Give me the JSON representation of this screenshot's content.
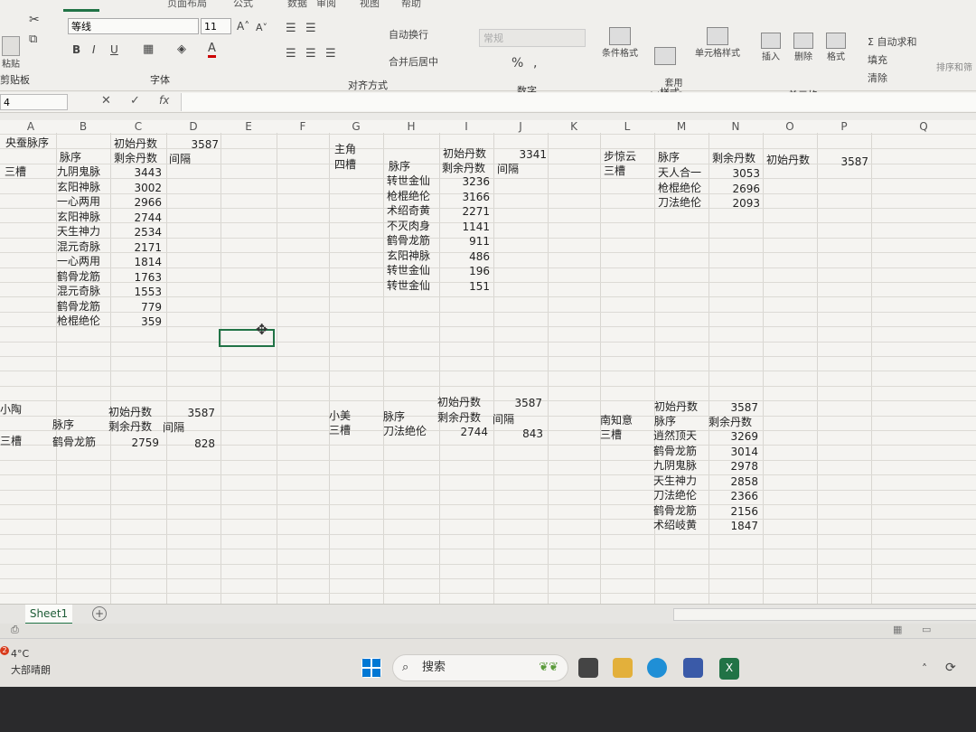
{
  "ribbon": {
    "tabs": [
      "页面布局",
      "公式",
      "数据",
      "审阅",
      "视图",
      "帮助"
    ],
    "font_name": "等线",
    "font_size": "11",
    "number_format": "常规",
    "wrap_text": "自动换行",
    "merge_center": "合并后居中",
    "cond_format": "条件格式",
    "table_format": "套用\n表格格式",
    "cell_style": "单元格样式",
    "insert": "插入",
    "delete": "删除",
    "format": "格式",
    "autosum": "自动求和",
    "fill": "填充",
    "clear": "清除",
    "sort": "排序和筛",
    "groups": {
      "clipboard": "剪贴板",
      "font": "字体",
      "align": "对齐方式",
      "number": "数字",
      "styles": "样式",
      "cells": "单元格",
      "edit": "编辑"
    },
    "paste": "粘贴",
    "bold": "B",
    "italic": "I",
    "underline": "U"
  },
  "formula_bar": {
    "name_box": "4",
    "fx": "fx"
  },
  "columns": [
    "A",
    "B",
    "C",
    "D",
    "E",
    "F",
    "G",
    "H",
    "I",
    "J",
    "K",
    "L",
    "M",
    "N",
    "O",
    "P",
    "Q",
    "R"
  ],
  "sheet_tab": "Sheet1",
  "taskbar": {
    "weather_temp": "4°C",
    "weather_desc": "大部晴朗",
    "search": "搜索",
    "badge": "2"
  },
  "accent": "#217346",
  "block1": {
    "title": "央蚕脉序",
    "h1": "初始丹数",
    "v1": "3587",
    "h_mai": "脉序",
    "h_rem": "剩余丹数",
    "h_gap": "间隔",
    "slot": "三槽",
    "rows": [
      [
        "九阴鬼脉",
        "3443"
      ],
      [
        "玄阳神脉",
        "3002"
      ],
      [
        "一心两用",
        "2966"
      ],
      [
        "玄阳神脉",
        "2744"
      ],
      [
        "天生神力",
        "2534"
      ],
      [
        "混元奇脉",
        "2171"
      ],
      [
        "一心两用",
        "1814"
      ],
      [
        "鹤骨龙筋",
        "1763"
      ],
      [
        "混元奇脉",
        "1553"
      ],
      [
        "鹤骨龙筋",
        "779"
      ],
      [
        "枪棍绝伦",
        "359"
      ]
    ]
  },
  "block2": {
    "title": "主角",
    "h1": "初始丹数",
    "v1": "3341",
    "slot": "四槽",
    "h_mai": "脉序",
    "h_rem": "剩余丹数",
    "h_gap": "间隔",
    "rows": [
      [
        "转世金仙",
        "3236"
      ],
      [
        "枪棍绝伦",
        "3166"
      ],
      [
        "术绍奇黄",
        "2271"
      ],
      [
        "不灭肉身",
        "1141"
      ],
      [
        "鹤骨龙筋",
        "911"
      ],
      [
        "玄阳神脉",
        "486"
      ],
      [
        "转世金仙",
        "196"
      ],
      [
        "转世金仙",
        "151"
      ]
    ]
  },
  "block3": {
    "title": "步惊云",
    "slot": "三槽",
    "h_mai": "脉序",
    "h_rem": "剩余丹数",
    "h_init": "初始丹数",
    "v1": "3587",
    "rows": [
      [
        "天人合一",
        "3053"
      ],
      [
        "枪棍绝伦",
        "2696"
      ],
      [
        "刀法绝伦",
        "2093"
      ]
    ]
  },
  "block4": {
    "title": "小陶",
    "slot": "三槽",
    "h1": "初始丹数",
    "v1": "3587",
    "h_mai": "脉序",
    "h_rem": "剩余丹数",
    "h_gap": "间隔",
    "row": [
      "鹤骨龙筋",
      "2759",
      "828"
    ]
  },
  "block5": {
    "title": "小美",
    "slot": "三槽",
    "h1": "初始丹数",
    "v1": "3587",
    "h_mai": "脉序",
    "h_rem": "剩余丹数",
    "h_gap": "间隔",
    "row": [
      "刀法绝伦",
      "2744",
      "843"
    ]
  },
  "block6": {
    "title": "南知意",
    "slot": "三槽",
    "h1": "初始丹数",
    "v1": "3587",
    "h_mai": "脉序",
    "h_rem": "剩余丹数",
    "rows": [
      [
        "逍然顶天",
        "3269"
      ],
      [
        "鹤骨龙筋",
        "3014"
      ],
      [
        "九阴鬼脉",
        "2978"
      ],
      [
        "天生神力",
        "2858"
      ],
      [
        "刀法绝伦",
        "2366"
      ],
      [
        "鹤骨龙筋",
        "2156"
      ],
      [
        "术绍岐黄",
        "1847"
      ]
    ]
  }
}
